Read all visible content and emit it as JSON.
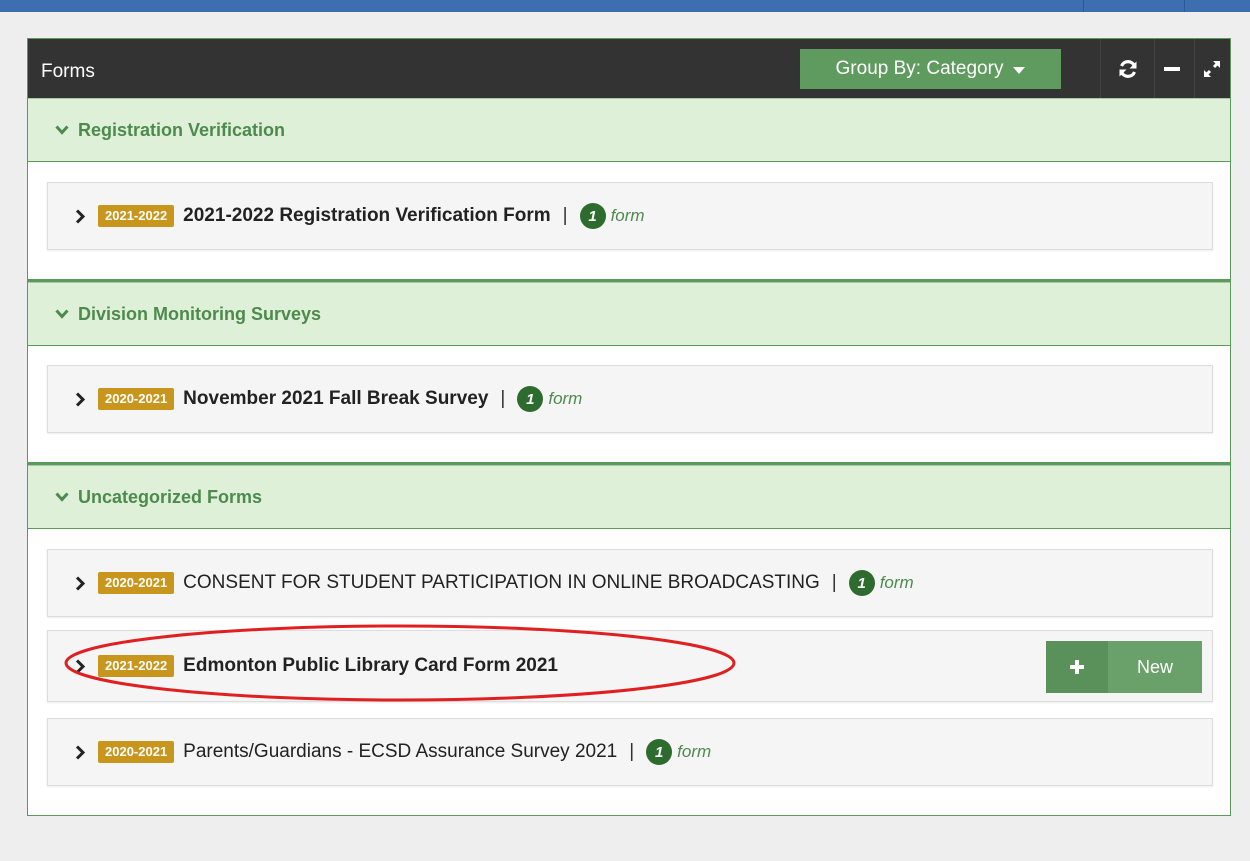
{
  "panel": {
    "title": "Forms",
    "group_by_label": "Group By: Category",
    "header_icons": [
      "refresh-icon",
      "minimize-icon",
      "expand-icon"
    ]
  },
  "categories": [
    {
      "name": "Registration Verification",
      "forms": [
        {
          "year": "2021-2022",
          "name": "2021-2022 Registration Verification Form",
          "separator": "|",
          "count": "1",
          "count_label": "form"
        }
      ]
    },
    {
      "name": "Division Monitoring Surveys",
      "forms": [
        {
          "year": "2020-2021",
          "name": "November 2021 Fall Break Survey",
          "separator": "|",
          "count": "1",
          "count_label": "form"
        }
      ]
    },
    {
      "name": "Uncategorized Forms",
      "forms": [
        {
          "year": "2020-2021",
          "name": "CONSENT FOR STUDENT PARTICIPATION IN ONLINE BROADCASTING",
          "separator": "|",
          "count": "1",
          "count_label": "form"
        },
        {
          "year": "2021-2022",
          "name": "Edmonton Public Library Card Form 2021",
          "new_button_label": "New"
        },
        {
          "year": "2020-2021",
          "name": "Parents/Guardians - ECSD Assurance Survey 2021",
          "separator": "|",
          "count": "1",
          "count_label": "form"
        }
      ]
    }
  ],
  "colors": {
    "header_bg": "#333333",
    "category_bg": "#dff0d8",
    "category_text": "#4d8a4d",
    "year_badge": "#c9961d",
    "count_badge": "#2e6b2e",
    "highlight_ellipse": "#e02020"
  }
}
